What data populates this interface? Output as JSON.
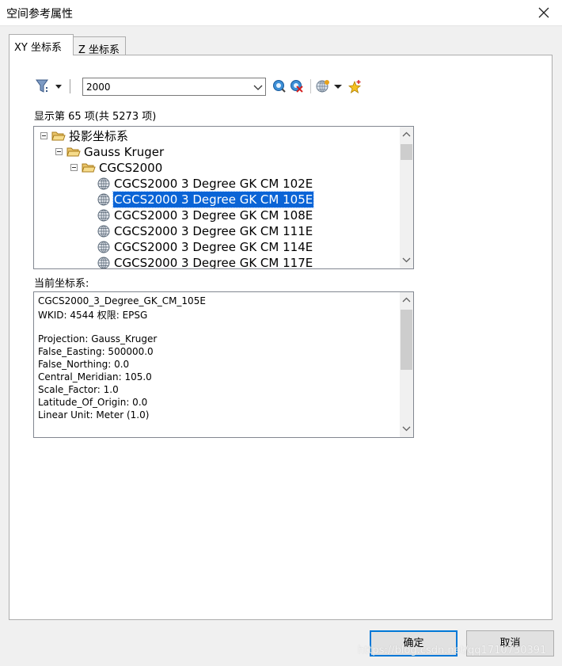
{
  "window": {
    "title": "空间参考属性"
  },
  "tabs": [
    {
      "label": "XY 坐标系",
      "active": true
    },
    {
      "label": "Z 坐标系",
      "active": false
    }
  ],
  "toolbar": {
    "search_value": "2000",
    "icons": [
      "filter-icon",
      "search-icon",
      "clear-search-icon",
      "globe-menu-icon",
      "add-favorite-icon"
    ]
  },
  "result_count": "显示第 65 项(共 5273 项)",
  "tree": [
    {
      "label": "投影坐标系",
      "type": "folder",
      "level": 0,
      "expanded": true
    },
    {
      "label": "Gauss Kruger",
      "type": "folder",
      "level": 1,
      "expanded": true
    },
    {
      "label": "CGCS2000",
      "type": "folder",
      "level": 2,
      "expanded": true
    },
    {
      "label": "CGCS2000 3 Degree GK CM 102E",
      "type": "crs",
      "level": 3
    },
    {
      "label": "CGCS2000 3 Degree GK CM 105E",
      "type": "crs",
      "level": 3,
      "selected": true
    },
    {
      "label": "CGCS2000 3 Degree GK CM 108E",
      "type": "crs",
      "level": 3
    },
    {
      "label": "CGCS2000 3 Degree GK CM 111E",
      "type": "crs",
      "level": 3
    },
    {
      "label": "CGCS2000 3 Degree GK CM 114E",
      "type": "crs",
      "level": 3
    },
    {
      "label": "CGCS2000 3 Degree GK CM 117E",
      "type": "crs",
      "level": 3
    }
  ],
  "current_label": "当前坐标系:",
  "details": [
    "CGCS2000_3_Degree_GK_CM_105E",
    "WKID: 4544 权限: EPSG",
    "",
    "Projection: Gauss_Kruger",
    "False_Easting: 500000.0",
    "False_Northing: 0.0",
    "Central_Meridian: 105.0",
    "Scale_Factor: 1.0",
    "Latitude_Of_Origin: 0.0",
    "Linear Unit: Meter (1.0)"
  ],
  "buttons": {
    "ok": "确定",
    "cancel": "取消"
  },
  "watermark": "https://blog.csdn.net/qq1710730391",
  "colors": {
    "selection": "#0a64d6",
    "default_button_border": "#0078d7"
  }
}
